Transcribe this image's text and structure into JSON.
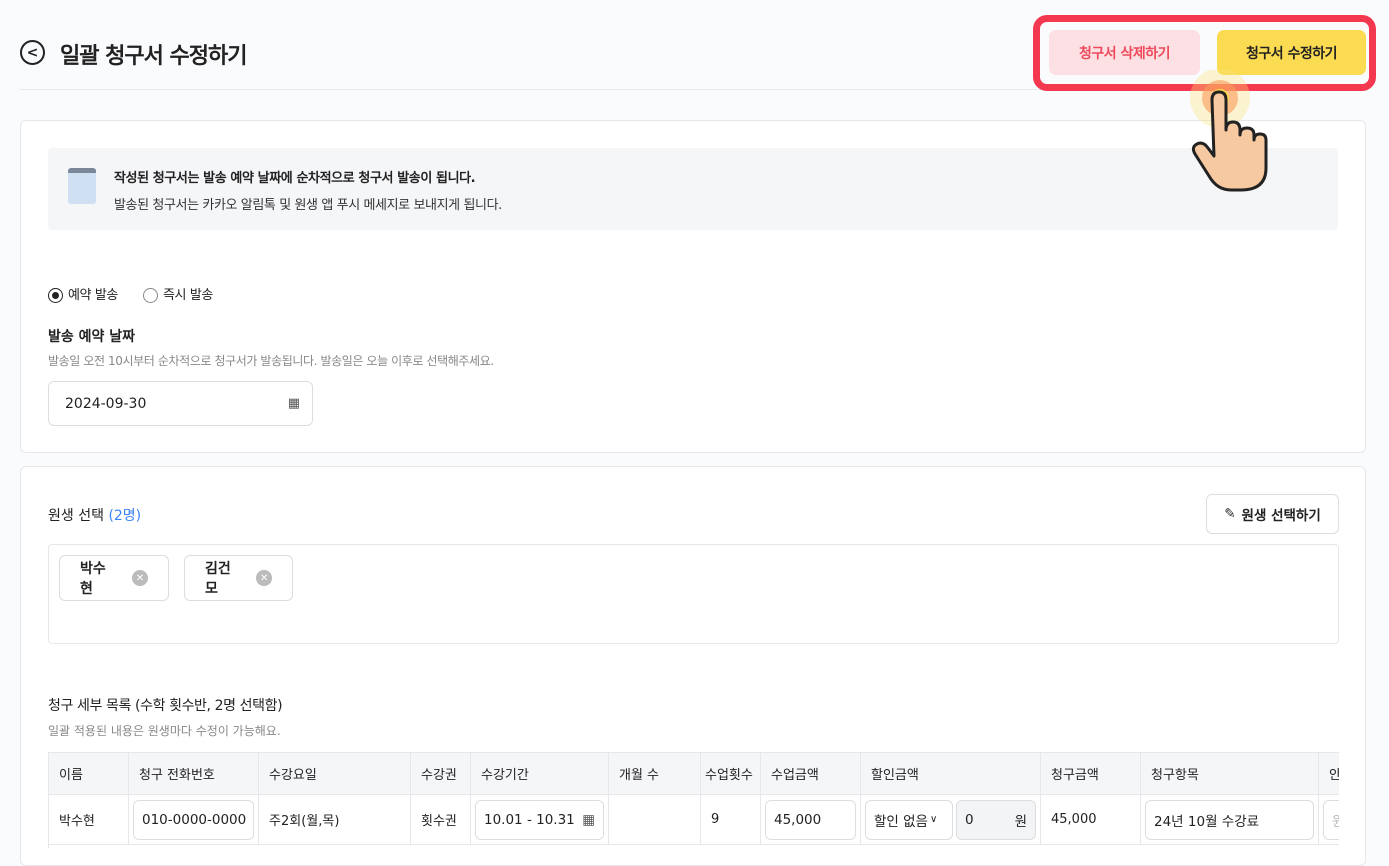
{
  "header": {
    "title": "일괄 청구서 수정하기",
    "delete_label": "청구서 삭제하기",
    "edit_label": "청구서 수정하기"
  },
  "notice": {
    "line1": "작성된 청구서는 발송 예약 날짜에 순차적으로 청구서 발송이 됩니다.",
    "line2": "발송된 청구서는 카카오 알림톡 및 원생 앱 푸시 메세지로 보내지게 됩니다."
  },
  "send": {
    "option_reserved": "예약 발송",
    "option_now": "즉시 발송",
    "date_label": "발송 예약 날짜",
    "date_help": "발송일 오전 10시부터 순차적으로 청구서가 발송됩니다. 발송일은 오늘 이후로 선택해주세요.",
    "date_value": "2024-09-30"
  },
  "students": {
    "label": "원생 선택",
    "count": "(2명)",
    "select_button": "원생 선택하기",
    "chips": [
      "박수현",
      "김건모"
    ]
  },
  "details": {
    "title": "청구 세부 목록 (수학 횟수반, 2명 선택함)",
    "help": "일괄 적용된 내용은 원생마다 수정이 가능해요.",
    "columns": [
      "이름",
      "청구 전화번호",
      "수강요일",
      "수강권",
      "수강기간",
      "개월 수",
      "수업횟수",
      "수업금액",
      "할인금액",
      "청구금액",
      "청구항목",
      "안"
    ],
    "rows": [
      {
        "name": "박수현",
        "phone": "010-0000-0000",
        "days": "주2회(월,목)",
        "ticket": "횟수권",
        "period": "10.01 - 10.31",
        "months": "",
        "count": "9",
        "price": "45,000",
        "discount_type": "할인 없음",
        "discount": "0",
        "unit": "원",
        "total": "45,000",
        "item": "24년 10월 수강료",
        "extra": "원"
      }
    ]
  }
}
